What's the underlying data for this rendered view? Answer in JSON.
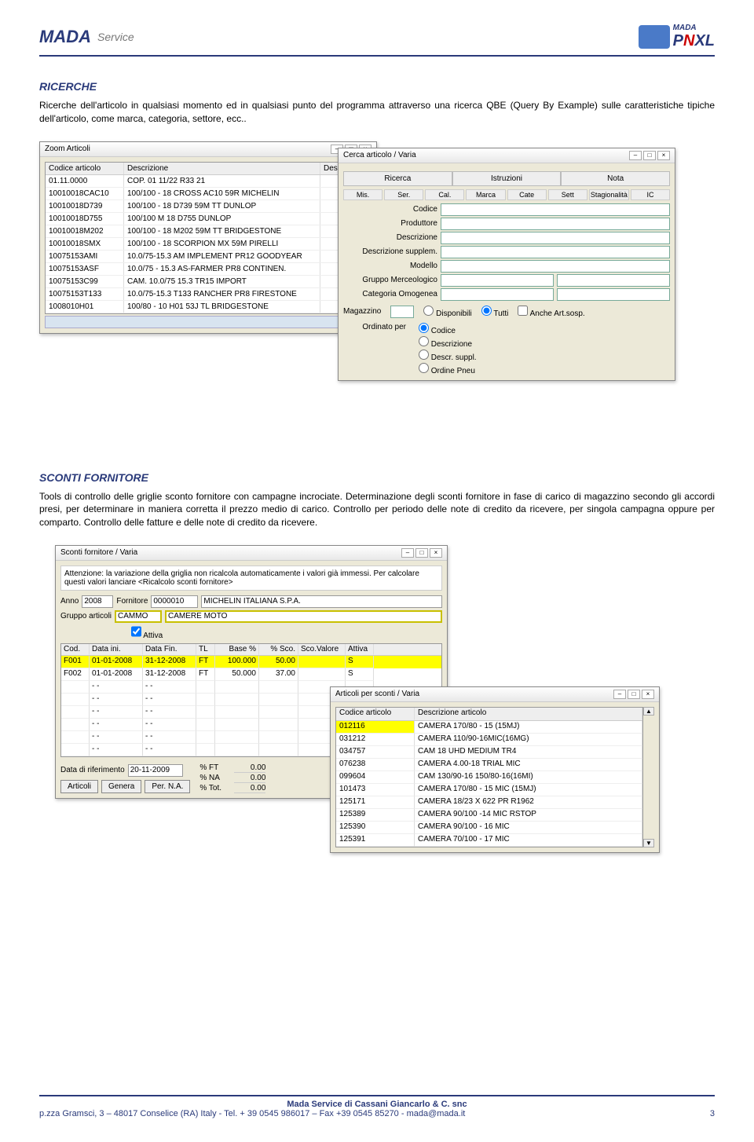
{
  "header": {
    "logo_left_text": "MADA",
    "logo_left_sub": "Service",
    "logo_right_small": "MADA",
    "logo_right_main": "PNXL"
  },
  "section1": {
    "title": "RICERCHE",
    "body": "Ricerche dell'articolo in qualsiasi momento ed in qualsiasi punto del programma attraverso una ricerca QBE (Query By Example) sulle caratteristiche tipiche dell'articolo, come marca, categoria, settore, ecc.."
  },
  "zoom": {
    "title": "Zoom Articoli",
    "headers": [
      "Codice articolo",
      "Descrizione",
      "Descr"
    ],
    "rows": [
      [
        "01.11.0000",
        "COP. 01 11/22 R33 21",
        ""
      ],
      [
        "10010018CAC10",
        "100/100 - 18 CROSS AC10  59R  MICHELIN",
        ""
      ],
      [
        "10010018D739",
        "100/100 - 18 D739  59M  TT    DUNLOP",
        ""
      ],
      [
        "10010018D755",
        "100/100 M 18 D755          DUNLOP",
        ""
      ],
      [
        "10010018M202",
        "100/100 - 18 M202  59M TT  BRIDGESTONE",
        ""
      ],
      [
        "10010018SMX",
        "100/100 - 18 SCORPION MX  59M   PIRELLI",
        ""
      ],
      [
        "10075153AMI",
        "10.0/75-15.3 AM IMPLEMENT PR12 GOODYEAR",
        ""
      ],
      [
        "10075153ASF",
        "10.0/75 - 15.3 AS-FARMER  PR8  CONTINEN.",
        ""
      ],
      [
        "10075153C99",
        "CAM. 10.0/75 15.3  TR15        IMPORT",
        ""
      ],
      [
        "10075153T133",
        "10.0/75-15.3 T133 RANCHER PR8  FIRESTONE",
        ""
      ],
      [
        "1008010H01",
        "100/80 - 10 H01 53J TL      BRIDGESTONE",
        ""
      ]
    ]
  },
  "cerca": {
    "title": "Cerca articolo / Varia",
    "tabs": [
      "Ricerca",
      "Istruzioni",
      "Nota"
    ],
    "small_cols": [
      "Mis.",
      "Ser.",
      "Cal.",
      "Marca",
      "Cate",
      "Sett",
      "Stagionalità",
      "IC"
    ],
    "fields": [
      "Codice",
      "Produttore",
      "Descrizione",
      "Descrizione supplem.",
      "Modello",
      "Gruppo Merceologico",
      "Categoria Omogenea"
    ],
    "magazzino_label": "Magazzino",
    "disponibili_label": "Disponibili",
    "tutti_label": "Tutti",
    "anche_label": "Anche Art.sosp.",
    "ordinato_label": "Ordinato per",
    "radios": [
      "Codice",
      "Descrizione",
      "Descr. suppl.",
      "Ordine Pneu"
    ]
  },
  "section2": {
    "title": "SCONTI FORNITORE",
    "body": "Tools di controllo delle griglie sconto fornitore con campagne incrociate. Determinazione degli sconti fornitore in fase di carico di magazzino secondo gli accordi presi, per determinare in maniera corretta il prezzo medio di carico. Controllo per periodo delle note di credito da ricevere, per singola campagna oppure per comparto. Controllo delle fatture e delle note di credito da ricevere."
  },
  "sconti": {
    "title": "Sconti fornitore / Varia",
    "msg": "Attenzione: la variazione della griglia non ricalcola automaticamente i valori già immessi. Per calcolare questi valori lanciare <Ricalcolo sconti fornitore>",
    "anno_label": "Anno",
    "anno_val": "2008",
    "fornitore_label": "Fornitore",
    "fornitore_code": "0000010",
    "fornitore_name": "MICHELIN ITALIANA S.P.A.",
    "gruppo_label": "Gruppo articoli",
    "gruppo_code": "CAMMO",
    "gruppo_name": "CAMERE MOTO",
    "attiva_label": "Attiva",
    "grid_headers": [
      "Cod.",
      "Data ini.",
      "Data Fin.",
      "TL",
      "Base %",
      "% Sco.",
      "Sco.Valore",
      "Attiva"
    ],
    "grid_rows": [
      [
        "F001",
        "01-01-2008",
        "31-12-2008",
        "FT",
        "100.000",
        "50.00",
        "",
        "S"
      ],
      [
        "F002",
        "01-01-2008",
        "31-12-2008",
        "FT",
        "50.000",
        "37.00",
        "",
        "S"
      ]
    ],
    "empty_rows": 6,
    "data_rif_label": "Data di riferimento",
    "data_rif_val": "20-11-2009",
    "btn_articoli": "Articoli",
    "btn_genera": "Genera",
    "btn_per": "Per. N.A.",
    "pct": [
      [
        "% FT",
        "0.00"
      ],
      [
        "% NA",
        "0.00"
      ],
      [
        "% Tot.",
        "0.00"
      ]
    ]
  },
  "articoli": {
    "title": "Articoli per sconti / Varia",
    "headers": [
      "Codice articolo",
      "Descrizione articolo"
    ],
    "rows": [
      [
        "012116",
        "CAMERA 170/80 - 15 (15MJ)"
      ],
      [
        "031212",
        "CAMERA 110/90-16MIC(16MG)"
      ],
      [
        "034757",
        "CAM 18 UHD MEDIUM TR4"
      ],
      [
        "076238",
        "CAMERA 4.00-18 TRIAL MIC"
      ],
      [
        "099604",
        "CAM 130/90-16 150/80-16(16MI)"
      ],
      [
        "101473",
        "CAMERA 170/80 - 15 MIC (15MJ)"
      ],
      [
        "125171",
        "CAMERA 18/23 X 622 PR R1962"
      ],
      [
        "125389",
        "CAMERA 90/100 -14 MIC RSTOP"
      ],
      [
        "125390",
        "CAMERA 90/100 - 16 MIC"
      ],
      [
        "125391",
        "CAMERA 70/100 - 17 MIC"
      ]
    ]
  },
  "footer": {
    "line1": "Mada Service di Cassani Giancarlo & C. snc",
    "line2_left": "p.zza Gramsci, 3 – 48017 Conselice (RA) Italy - Tel. + 39 0545 986017 – Fax +39 0545 85270 - mada@mada.it",
    "page_num": "3"
  }
}
